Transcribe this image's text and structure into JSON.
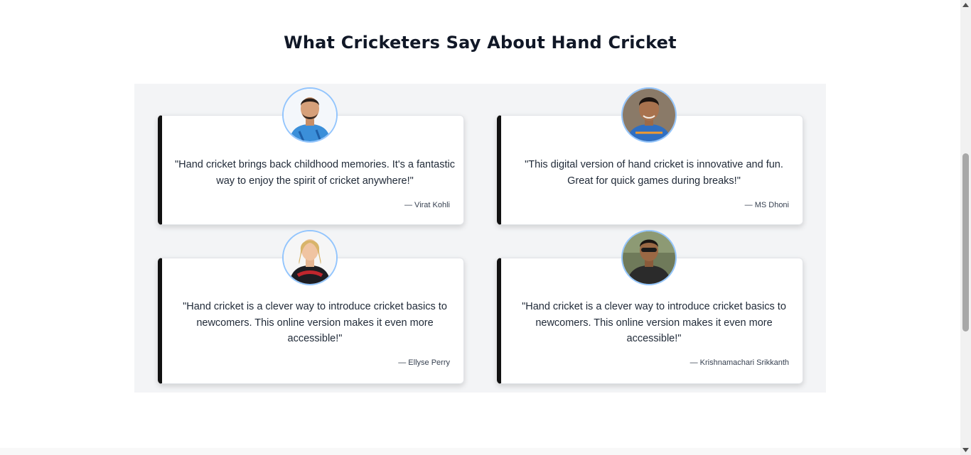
{
  "section": {
    "title": "What Cricketers Say About Hand Cricket"
  },
  "testimonials": [
    {
      "quote": "\"Hand cricket brings back childhood memories. It's a fantastic way to enjoy the spirit of cricket anywhere!\"",
      "author": "— Virat Kohli",
      "avatar_icon": "player-photo-icon"
    },
    {
      "quote": "\"This digital version of hand cricket is innovative and fun. Great for quick games during breaks!\"",
      "author": "— MS Dhoni",
      "avatar_icon": "player-photo-icon"
    },
    {
      "quote": "\"Hand cricket is a clever way to introduce cricket basics to newcomers. This online version makes it even more accessible!\"",
      "author": "— Ellyse Perry",
      "avatar_icon": "player-photo-icon"
    },
    {
      "quote": "\"Hand cricket is a clever way to introduce cricket basics to newcomers. This online version makes it even more accessible!\"",
      "author": "— Krishnamachari Srikkanth",
      "avatar_icon": "player-photo-icon"
    }
  ],
  "colors": {
    "heading": "#111827",
    "panel_background": "#f3f4f6",
    "card_accent_border": "#111111",
    "avatar_ring": "#93c5fd"
  }
}
